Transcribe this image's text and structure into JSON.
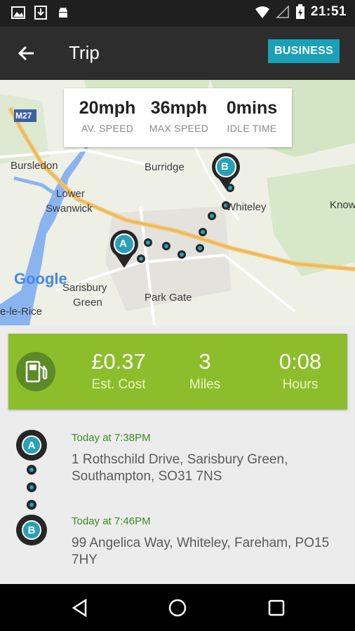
{
  "status_bar": {
    "time": "21:51"
  },
  "app_bar": {
    "title": "Trip",
    "business_label": "BUSINESS"
  },
  "map": {
    "road_label": "M27",
    "stats": [
      {
        "value": "20mph",
        "label": "AV. SPEED"
      },
      {
        "value": "36mph",
        "label": "MAX SPEED"
      },
      {
        "value": "0mins",
        "label": "IDLE TIME"
      }
    ],
    "places": {
      "bursledon": "Bursledon",
      "burridge": "Burridge",
      "lower_swanwick_1": "Lower",
      "lower_swanwick_2": "Swanwick",
      "whiteley": "Whiteley",
      "knowle": "Know",
      "sarisbury_1": "Sarisbury",
      "sarisbury_2": "Green",
      "park_gate": "Park Gate",
      "rice": "e-le-Rice"
    },
    "markers": {
      "start": "A",
      "end": "B"
    },
    "google": "Google"
  },
  "summary": {
    "cost": {
      "value": "£0.37",
      "label": "Est. Cost"
    },
    "miles": {
      "value": "3",
      "label": "Miles"
    },
    "hours": {
      "value": "0:08",
      "label": "Hours"
    }
  },
  "route": {
    "start": {
      "marker": "A",
      "time": "Today at 7:38PM",
      "address": "1 Rothschild Drive, Sarisbury Green, Southampton, SO31 7NS"
    },
    "end": {
      "marker": "B",
      "time": "Today at 7:46PM",
      "address": "99 Angelica Way, Whiteley, Fareham, PO15 7HY"
    }
  },
  "colors": {
    "accent": "#1aa1b8",
    "summary_green": "#8cbd2b",
    "time_green": "#3d8a23"
  }
}
